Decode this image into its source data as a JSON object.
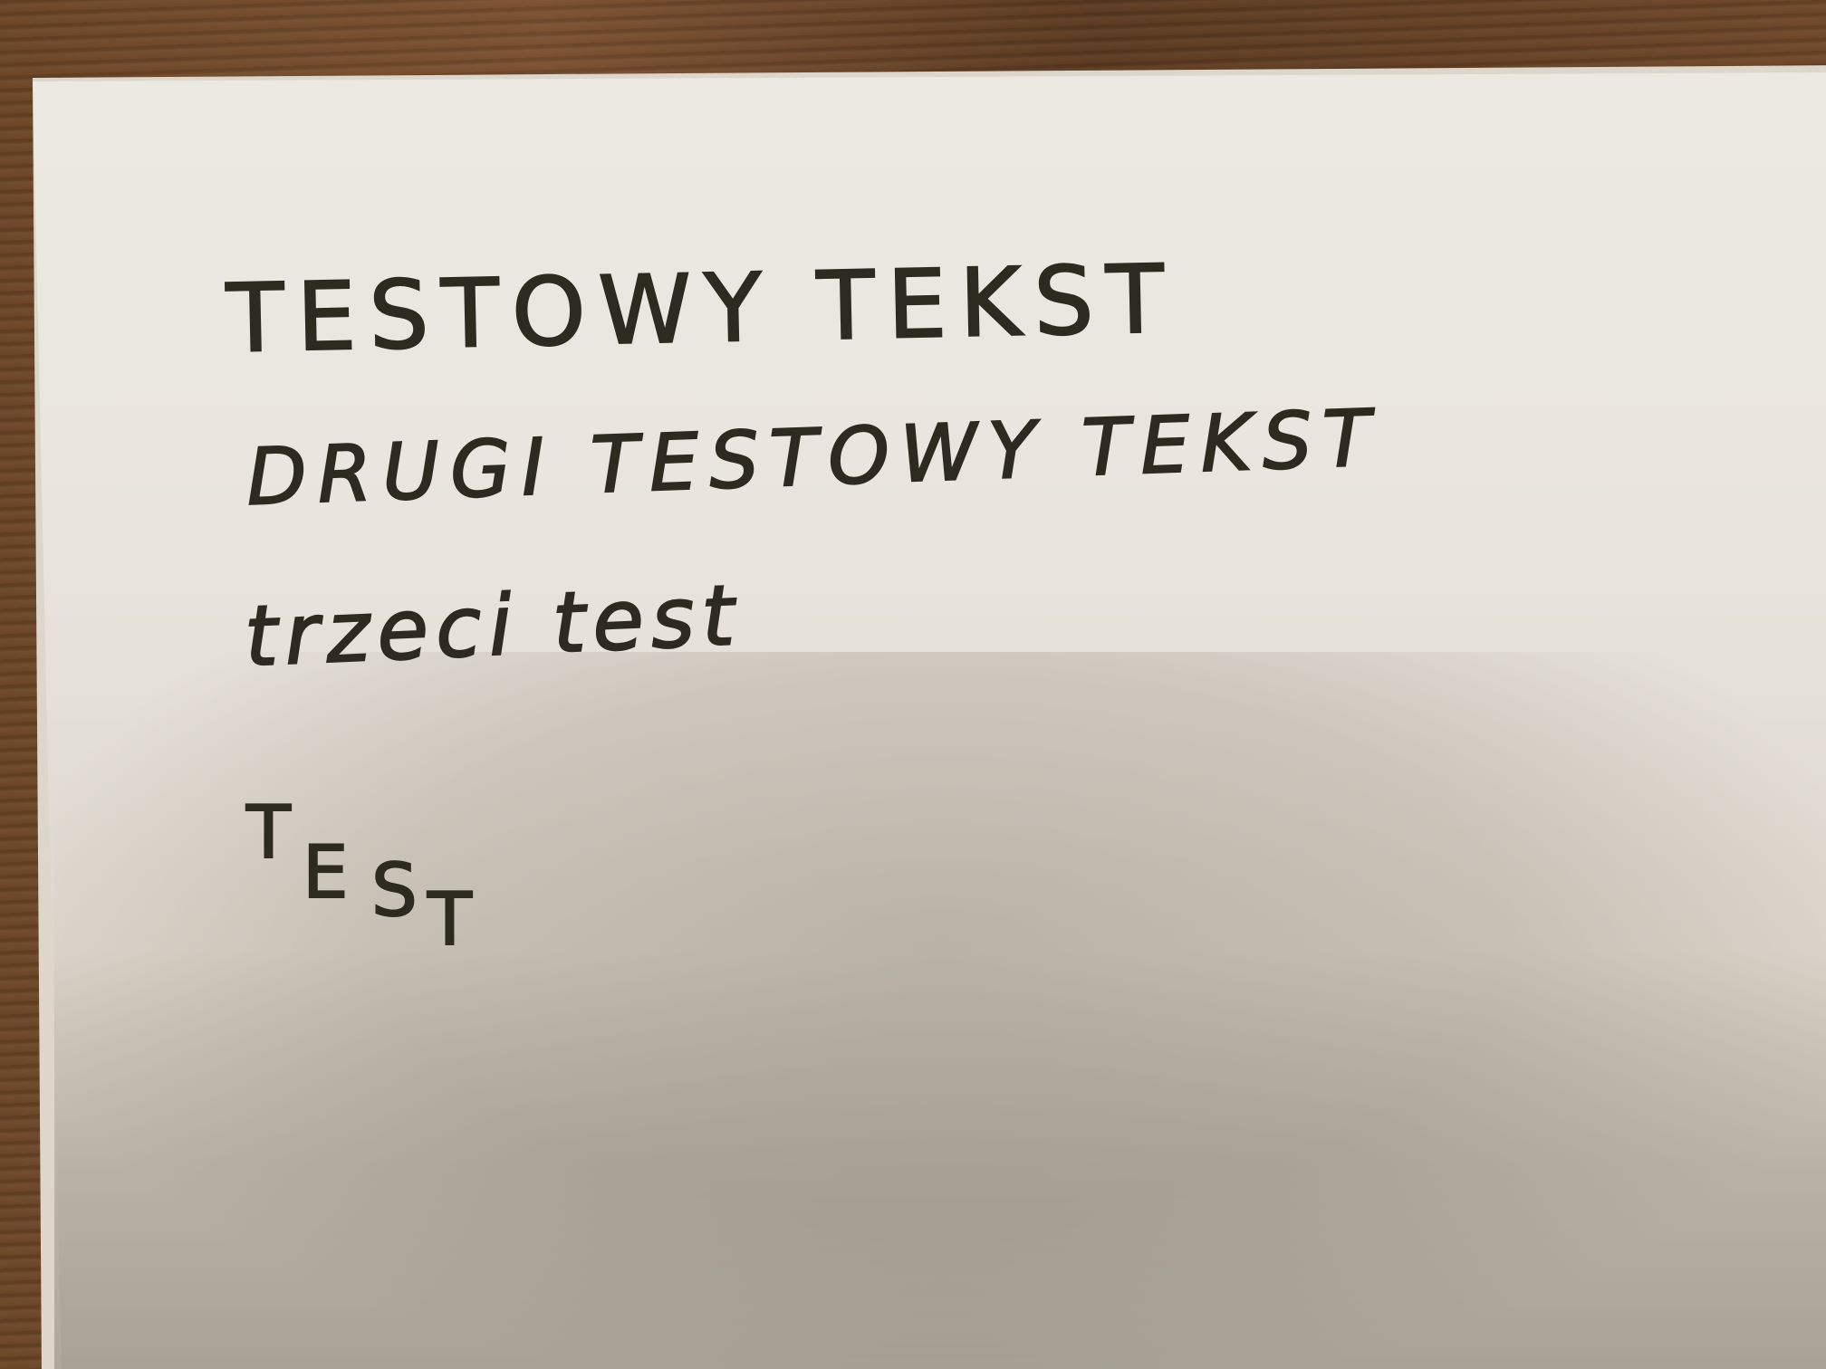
{
  "handwriting": {
    "line1": "TESTOWY TEKST",
    "line2": "DRUGI TESTOWY TEKST",
    "line3": "trzeci test",
    "staggered_word": [
      "T",
      "E",
      "S",
      "T"
    ]
  },
  "colors": {
    "ink": "#2d2a20",
    "paper": "#ece9e3",
    "table_wood": "#6b4526"
  }
}
